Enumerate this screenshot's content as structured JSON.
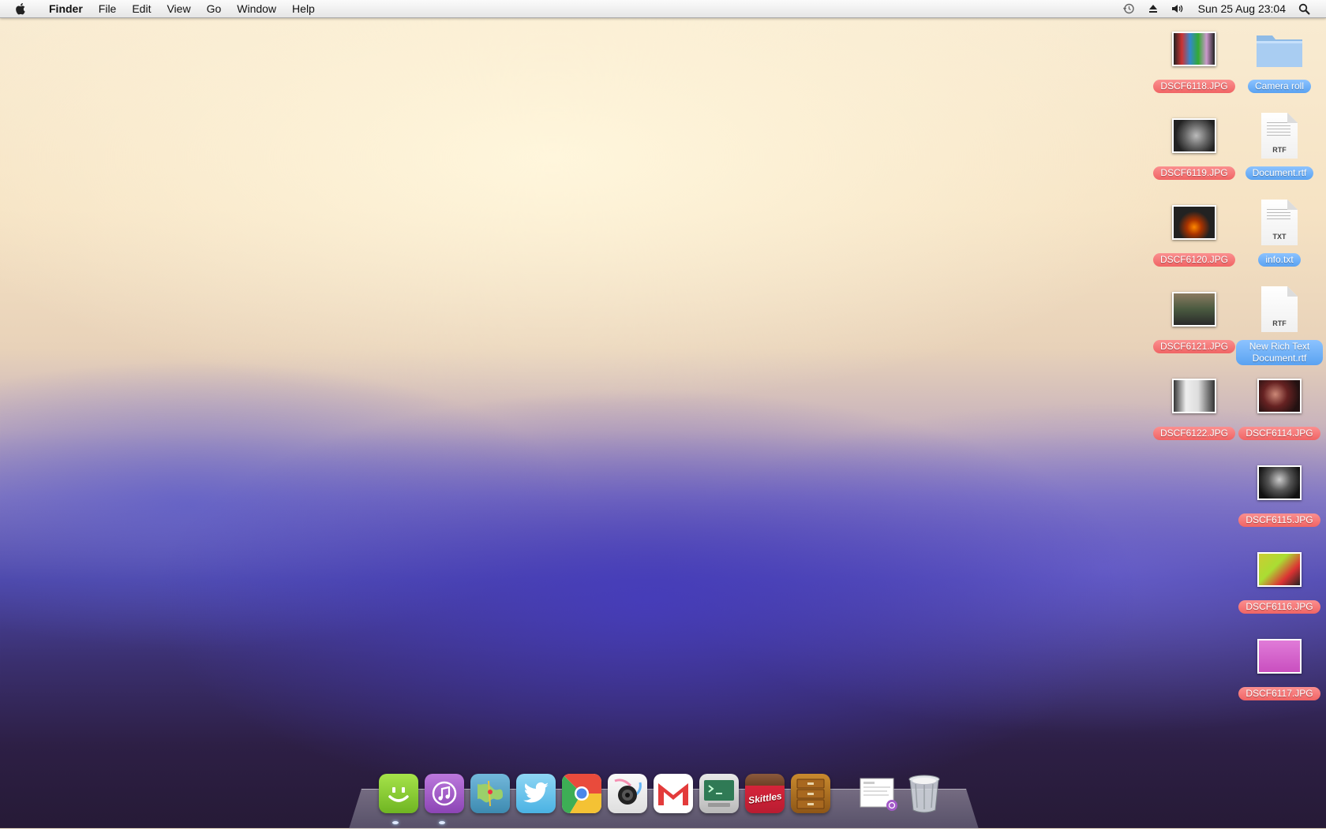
{
  "menubar": {
    "app_name": "Finder",
    "menus": [
      "File",
      "Edit",
      "View",
      "Go",
      "Window",
      "Help"
    ],
    "clock": "Sun 25 Aug  23:04",
    "status_icons": [
      "time-machine-icon",
      "eject-icon",
      "volume-icon"
    ]
  },
  "desktop": {
    "icons": [
      {
        "label": "DSCF6118.JPG",
        "kind": "photo",
        "tag": "red"
      },
      {
        "label": "Camera roll",
        "kind": "folder",
        "tag": "blue"
      },
      {
        "label": "DSCF6119.JPG",
        "kind": "photo",
        "tag": "red"
      },
      {
        "label": "Document.rtf",
        "kind": "document",
        "ext": "RTF",
        "tag": "blue"
      },
      {
        "label": "DSCF6120.JPG",
        "kind": "photo",
        "tag": "red"
      },
      {
        "label": "info.txt",
        "kind": "document",
        "ext": "TXT",
        "tag": "blue"
      },
      {
        "label": "DSCF6121.JPG",
        "kind": "photo",
        "tag": "red"
      },
      {
        "label": "New Rich Text Document.rtf",
        "kind": "document",
        "ext": "RTF",
        "tag": "blue"
      },
      {
        "label": "DSCF6122.JPG",
        "kind": "photo",
        "tag": "red"
      },
      {
        "label": "DSCF6114.JPG",
        "kind": "photo",
        "tag": "red"
      },
      {
        "label": "DSCF6115.JPG",
        "kind": "photo",
        "tag": "red"
      },
      {
        "label": "DSCF6116.JPG",
        "kind": "photo",
        "tag": "red"
      },
      {
        "label": "DSCF6117.JPG",
        "kind": "photo",
        "tag": "red"
      }
    ]
  },
  "dock": {
    "items": [
      {
        "name": "finder-smiley-icon",
        "color": "#8fd13a",
        "running": true
      },
      {
        "name": "itunes-icon",
        "color": "#a05ac8",
        "running": true
      },
      {
        "name": "maps-icon",
        "color": "#5aa7c9",
        "running": false
      },
      {
        "name": "twitter-icon",
        "color": "#6ec4ec",
        "running": false
      },
      {
        "name": "chrome-icon",
        "color": "#f2c23b",
        "running": false
      },
      {
        "name": "camera-icon",
        "color": "#f4f4f4",
        "running": false
      },
      {
        "name": "gmail-icon",
        "color": "#ffffff",
        "running": false
      },
      {
        "name": "terminal-icon",
        "color": "#dcdcdc",
        "running": false
      },
      {
        "name": "skittles-icon",
        "color": "#d6243a",
        "running": false
      },
      {
        "name": "drawer-icon",
        "color": "#b9741f",
        "running": false
      },
      {
        "name": "documents-stack-icon",
        "color": "#f2f2f2",
        "running": false
      },
      {
        "name": "trash-icon",
        "color": "#d8dde2",
        "running": false
      }
    ],
    "dock_label": "Skittles"
  }
}
